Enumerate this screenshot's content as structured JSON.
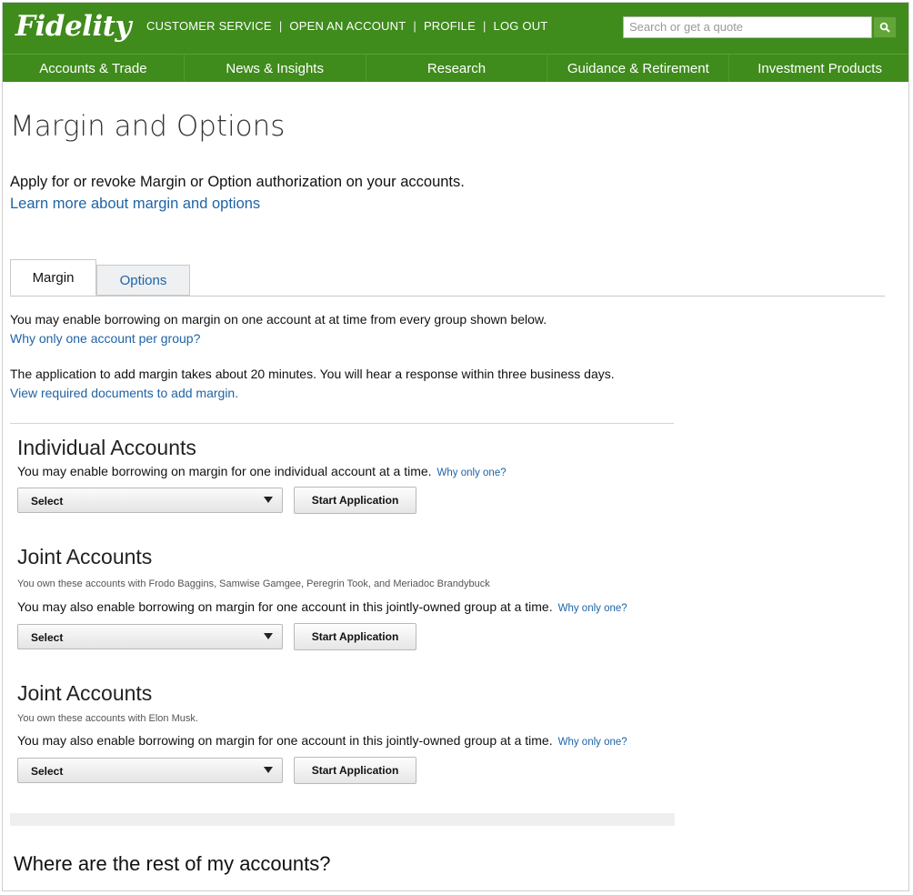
{
  "header": {
    "logo": "Fidelity",
    "links": [
      "CUSTOMER SERVICE",
      "OPEN AN ACCOUNT",
      "PROFILE",
      "LOG OUT"
    ],
    "search_placeholder": "Search or get a quote"
  },
  "nav": [
    "Accounts & Trade",
    "News & Insights",
    "Research",
    "Guidance & Retirement",
    "Investment Products"
  ],
  "page": {
    "title": "Margin and Options",
    "intro": "Apply for or revoke Margin or Option authorization on your accounts.",
    "learn_link": "Learn more about margin and options"
  },
  "tabs": {
    "margin": "Margin",
    "options": "Options"
  },
  "margin": {
    "line1": "You may enable borrowing on margin on one account at at time from every group shown below.",
    "link1": "Why only one account per group?",
    "line2": "The application to add margin takes about 20 minutes. You will hear a response within three business days.",
    "link2": "View required documents to add margin."
  },
  "sections": [
    {
      "title": "Individual Accounts",
      "owners": "",
      "desc": "You may enable borrowing on margin for one individual account at a time.",
      "why": "Why only one?",
      "select": "Select",
      "button": "Start Application"
    },
    {
      "title": "Joint Accounts",
      "owners": "You own these accounts with Frodo Baggins, Samwise Gamgee, Peregrin Took, and Meriadoc Brandybuck",
      "desc": "You may also enable borrowing on margin for one account in this jointly-owned group at a time.",
      "why": "Why only one?",
      "select": "Select",
      "button": "Start Application"
    },
    {
      "title": "Joint Accounts",
      "owners": "You own these accounts with Elon Musk.",
      "desc": "You may also enable borrowing on margin for one account in this jointly-owned group at a time.",
      "why": "Why only one?",
      "select": "Select",
      "button": "Start Application"
    }
  ],
  "footer_question": "Where are the rest of my accounts?",
  "colors": {
    "brand_green": "#3f8b1c",
    "link_blue": "#1e63a6"
  }
}
